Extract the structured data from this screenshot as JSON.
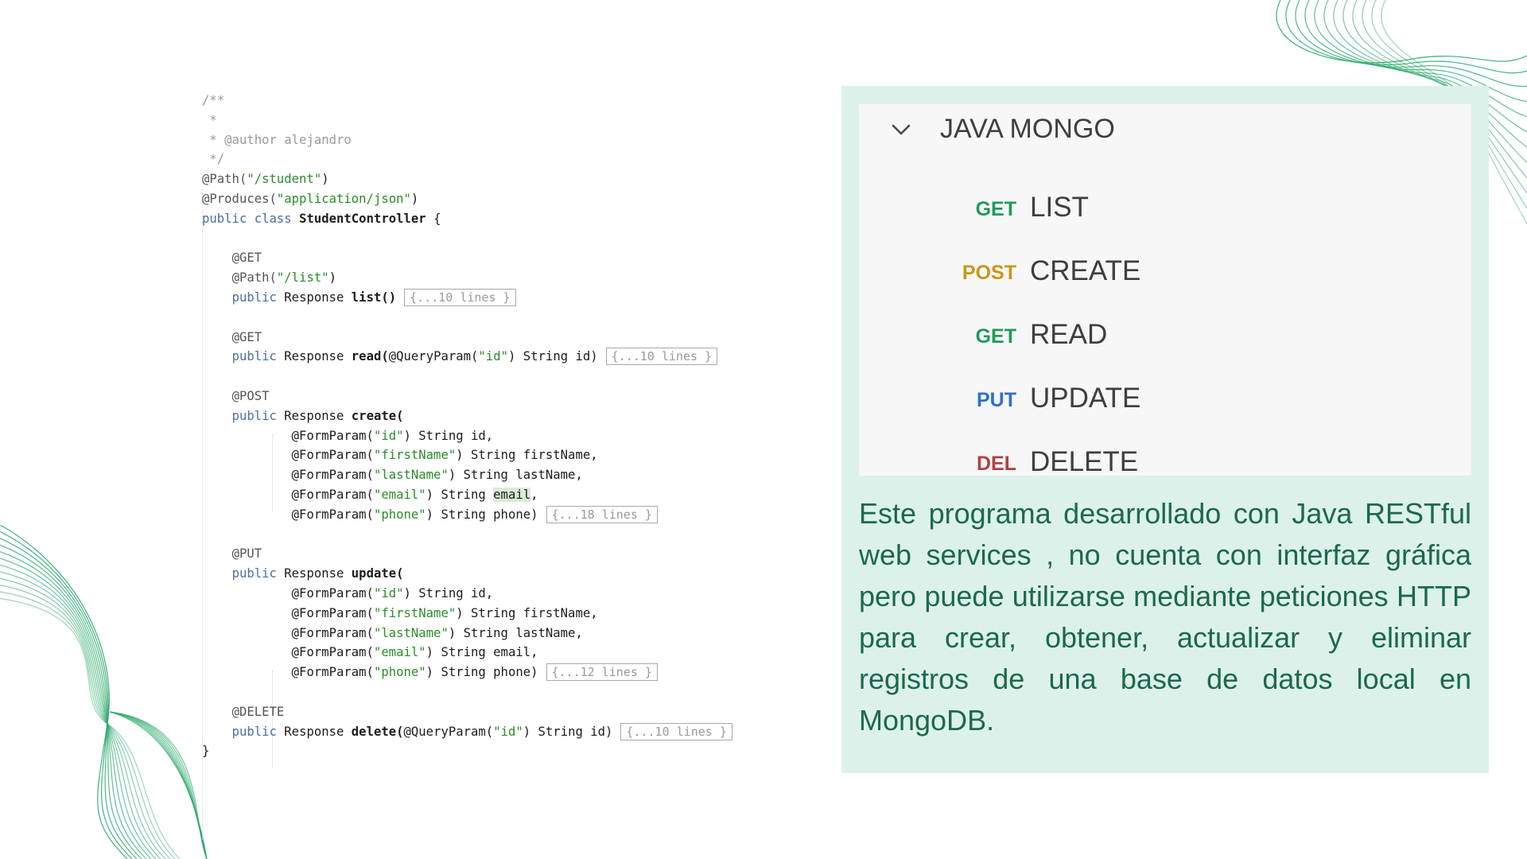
{
  "colors": {
    "panel_bg": "#ddf1eb",
    "description_text": "#1a6a4a",
    "decor_lines": "#2aa86a",
    "method_get": "#1f9a5a",
    "method_post": "#c9961a",
    "method_put": "#2d6fd1",
    "method_del": "#b0413e"
  },
  "code": {
    "comment_open": "/**",
    "comment_star": " *",
    "comment_author_tag": " * @author",
    "comment_author_name": " alejandro",
    "comment_close": " */",
    "path_ann": "@Path(",
    "path_value": "\"/student\"",
    "paren_close": ")",
    "produces_ann": "@Produces(",
    "produces_value": "\"application/json\"",
    "kw_public": "public",
    "kw_class": "class",
    "class_name": "StudentController",
    "brace_open": " {",
    "brace_close": "}",
    "ann_get": "@GET",
    "ann_post": "@POST",
    "ann_put": "@PUT",
    "ann_delete": "@DELETE",
    "list_path_value": "\"/list\"",
    "response_type": "Response",
    "m_list": "list()",
    "m_read": "read(",
    "m_create": "create(",
    "m_update": "update(",
    "m_delete": "delete(",
    "query_param": "@QueryParam(",
    "form_param": "@FormParam(",
    "str_id": "\"id\"",
    "str_first": "\"firstName\"",
    "str_last": "\"lastName\"",
    "str_email": "\"email\"",
    "str_phone": "\"phone\"",
    "p_id_close": ") String id)",
    "p_id": ") String id,",
    "p_first": ") String firstName,",
    "p_last": ") String lastName,",
    "p_email_pre": ") String ",
    "p_email_word": "email",
    "p_comma": ",",
    "p_email": ") String email,",
    "p_phone": ") String phone)",
    "fold_list": "{...10 lines }",
    "fold_read": "{...10 lines }",
    "fold_create": "{...18 lines }",
    "fold_update": "{...12 lines }",
    "fold_delete": "{...10 lines }"
  },
  "collection": {
    "title": "JAVA MONGO",
    "chevron_icon": "chevron-down-icon",
    "requests": [
      {
        "method": "GET",
        "name": "LIST"
      },
      {
        "method": "POST",
        "name": "CREATE"
      },
      {
        "method": "GET",
        "name": "READ"
      },
      {
        "method": "PUT",
        "name": "UPDATE"
      },
      {
        "method": "DEL",
        "name": "DELETE"
      }
    ]
  },
  "description": "Este programa desarrollado con Java RESTful web services , no cuenta con interfaz gráfica pero puede utilizarse mediante peticiones HTTP para crear, obtener, actualizar y eliminar registros de una base de datos local en MongoDB."
}
